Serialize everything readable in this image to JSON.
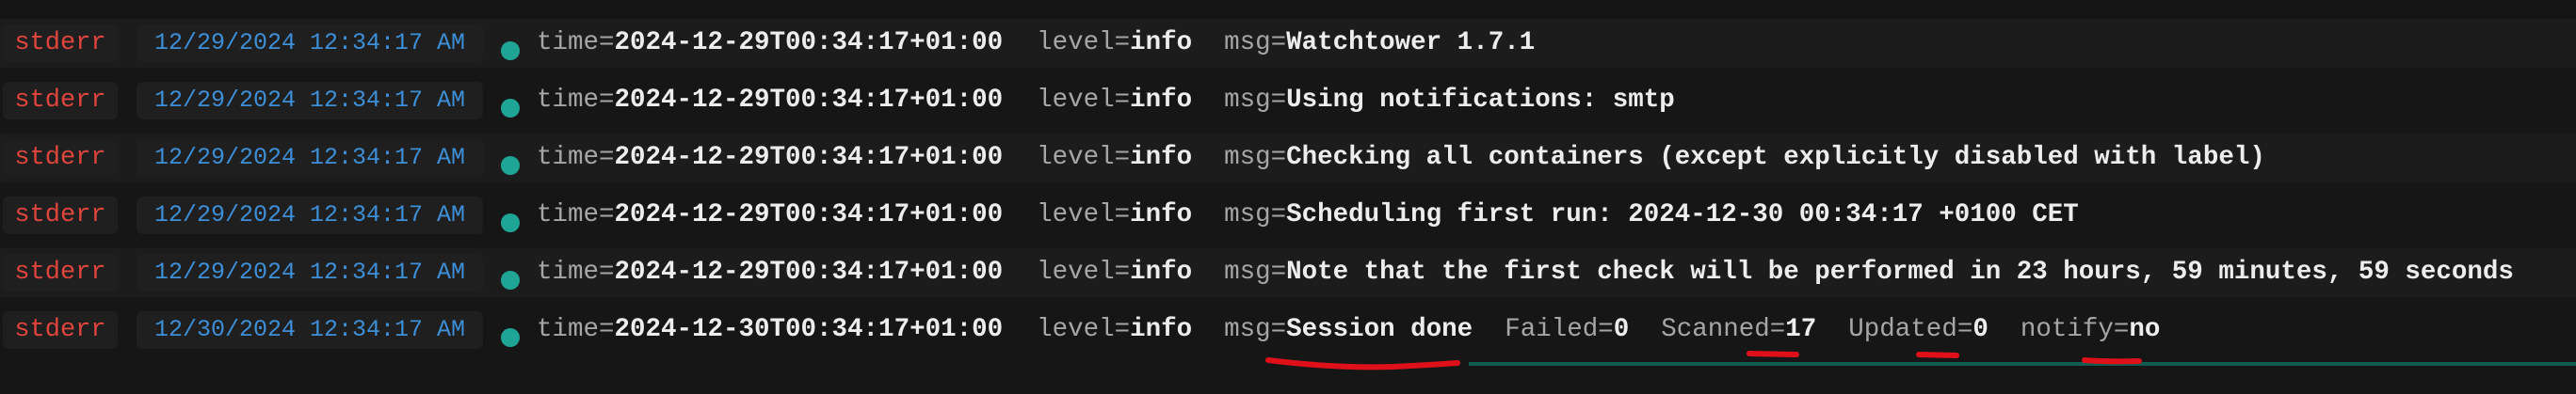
{
  "logs": [
    {
      "stream": "stderr",
      "timestamp": "12/29/2024 12:34:17 AM",
      "time_key": "time=",
      "time_value": "2024-12-29T00:34:17+01:00",
      "level_key": "level=",
      "level_value": "info",
      "msg_key": "msg=",
      "msg_value": "Watchtower 1.7.1"
    },
    {
      "stream": "stderr",
      "timestamp": "12/29/2024 12:34:17 AM",
      "time_key": "time=",
      "time_value": "2024-12-29T00:34:17+01:00",
      "level_key": "level=",
      "level_value": "info",
      "msg_key": "msg=",
      "msg_value": "Using notifications: smtp"
    },
    {
      "stream": "stderr",
      "timestamp": "12/29/2024 12:34:17 AM",
      "time_key": "time=",
      "time_value": "2024-12-29T00:34:17+01:00",
      "level_key": "level=",
      "level_value": "info",
      "msg_key": "msg=",
      "msg_value": "Checking all containers (except explicitly disabled with label)"
    },
    {
      "stream": "stderr",
      "timestamp": "12/29/2024 12:34:17 AM",
      "time_key": "time=",
      "time_value": "2024-12-29T00:34:17+01:00",
      "level_key": "level=",
      "level_value": "info",
      "msg_key": "msg=",
      "msg_value": "Scheduling first run: 2024-12-30 00:34:17 +0100 CET"
    },
    {
      "stream": "stderr",
      "timestamp": "12/29/2024 12:34:17 AM",
      "time_key": "time=",
      "time_value": "2024-12-29T00:34:17+01:00",
      "level_key": "level=",
      "level_value": "info",
      "msg_key": "msg=",
      "msg_value": "Note that the first check will be performed in 23 hours, 59 minutes, 59 seconds"
    },
    {
      "stream": "stderr",
      "timestamp": "12/30/2024 12:34:17 AM",
      "time_key": "time=",
      "time_value": "2024-12-30T00:34:17+01:00",
      "level_key": "level=",
      "level_value": "info",
      "msg_key": "msg=",
      "msg_value": "Session done",
      "failed_key": "Failed=",
      "failed_value": "0",
      "scanned_key": "Scanned=",
      "scanned_value": "17",
      "updated_key": "Updated=",
      "updated_value": "0",
      "notify_key": "notify=",
      "notify_value": "no"
    }
  ],
  "colors": {
    "stream": "#e0453d",
    "timestamp": "#3d8fd8",
    "status_dot": "#1ea596",
    "annotation": "#e0101a"
  },
  "icons": {
    "status": "status-dot-icon"
  }
}
